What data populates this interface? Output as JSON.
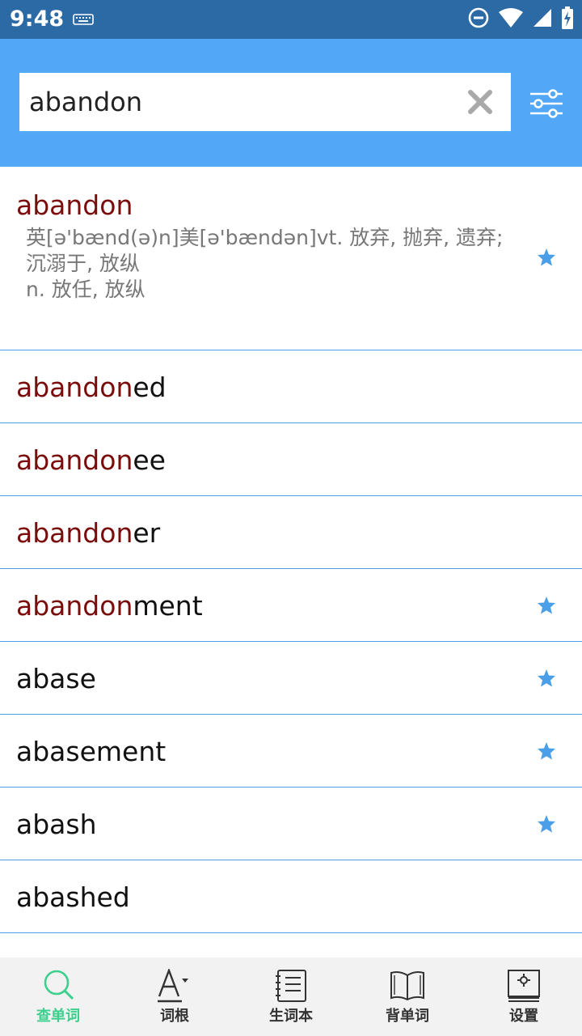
{
  "status_bar": {
    "time": "9:48"
  },
  "search": {
    "value": "abandon",
    "placeholder": ""
  },
  "colors": {
    "accent": "#52a8f7",
    "status_bar": "#2c6aa6",
    "headword": "#7a0c0c",
    "active_tab": "#3ccf8e",
    "divider": "#4a9fe8"
  },
  "main_entry": {
    "word": "abandon",
    "definition_lines": [
      "英[ə'bænd(ə)n]美[ə'bændən]vt. 放弃, 抛弃, 遗弃;",
      "沉溺于, 放纵",
      "n. 放任, 放纵"
    ],
    "starred": true
  },
  "results": [
    {
      "prefix": "abandon",
      "suffix": "ed",
      "starred": false
    },
    {
      "prefix": "abandon",
      "suffix": "ee",
      "starred": false
    },
    {
      "prefix": "abandon",
      "suffix": "er",
      "starred": false
    },
    {
      "prefix": "abandon",
      "suffix": "ment",
      "starred": true
    },
    {
      "prefix": "",
      "suffix": "abase",
      "starred": true
    },
    {
      "prefix": "",
      "suffix": "abasement",
      "starred": true
    },
    {
      "prefix": "",
      "suffix": "abash",
      "starred": true
    },
    {
      "prefix": "",
      "suffix": "abashed",
      "starred": false
    }
  ],
  "bottom_nav": [
    {
      "label": "查单词",
      "icon": "search-icon",
      "active": true
    },
    {
      "label": "词根",
      "icon": "font-icon",
      "active": false
    },
    {
      "label": "生词本",
      "icon": "notebook-icon",
      "active": false
    },
    {
      "label": "背单词",
      "icon": "book-icon",
      "active": false
    },
    {
      "label": "设置",
      "icon": "settings-icon",
      "active": false
    }
  ]
}
